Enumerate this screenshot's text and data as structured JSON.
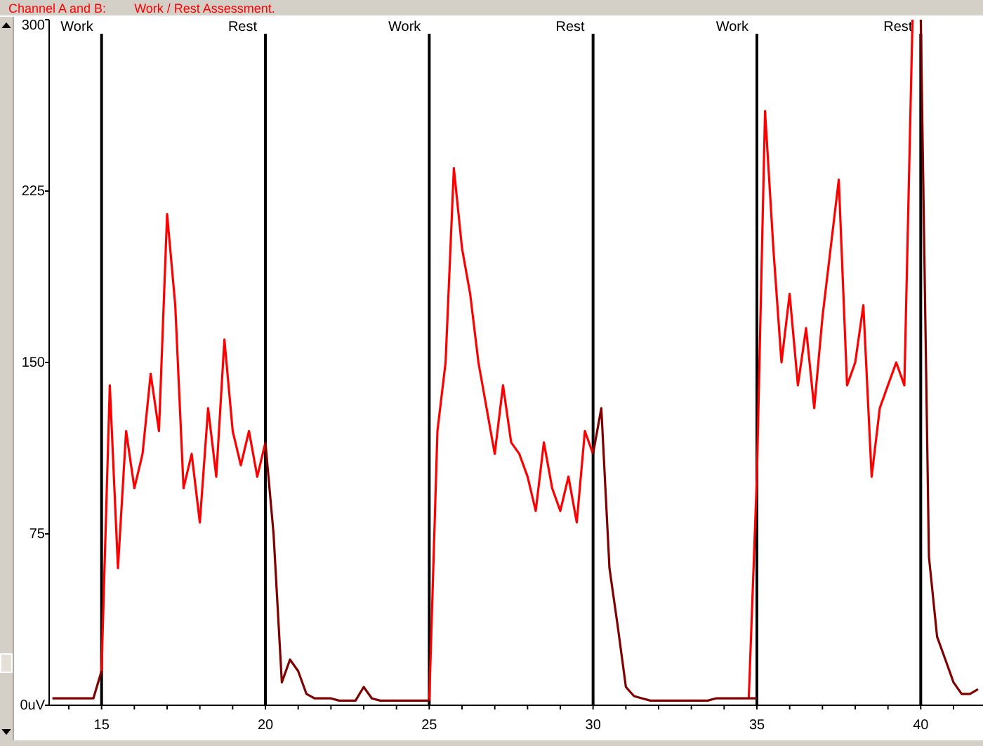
{
  "header": {
    "channel": "Channel A and B:",
    "title": "Work / Rest Assessment."
  },
  "chart": {
    "chart_data": {
      "type": "line",
      "x": [
        13.5,
        13.75,
        14,
        14.25,
        14.5,
        14.75,
        15,
        15.25,
        15.5,
        15.75,
        16,
        16.25,
        16.5,
        16.75,
        17,
        17.25,
        17.5,
        17.75,
        18,
        18.25,
        18.5,
        18.75,
        19,
        19.25,
        19.5,
        19.75,
        20,
        20.25,
        20.5,
        20.75,
        21,
        21.25,
        21.5,
        21.75,
        22,
        22.25,
        22.5,
        22.75,
        23,
        23.25,
        23.5,
        23.75,
        24,
        24.25,
        24.5,
        24.75,
        25,
        25.25,
        25.5,
        25.75,
        26,
        26.25,
        26.5,
        26.75,
        27,
        27.25,
        27.5,
        27.75,
        28,
        28.25,
        28.5,
        28.75,
        29,
        29.25,
        29.5,
        29.75,
        30,
        30.25,
        30.5,
        30.75,
        31,
        31.25,
        31.5,
        31.75,
        32,
        32.25,
        32.5,
        32.75,
        33,
        33.25,
        33.5,
        33.75,
        34,
        34.25,
        34.5,
        34.75,
        35,
        35.25,
        35.5,
        35.75,
        36,
        36.25,
        36.5,
        36.75,
        37,
        37.25,
        37.5,
        37.75,
        38,
        38.25,
        38.5,
        38.75,
        39,
        39.25,
        39.5,
        39.75,
        40,
        40.25,
        40.5,
        40.75,
        41,
        41.25,
        41.5,
        41.75
      ],
      "series": [
        {
          "color": "#ff0000",
          "values": [
            null,
            null,
            null,
            null,
            null,
            null,
            15,
            140,
            60,
            120,
            95,
            110,
            145,
            120,
            215,
            175,
            95,
            110,
            80,
            130,
            100,
            160,
            120,
            105,
            120,
            100,
            115,
            null,
            null,
            null,
            null,
            null,
            null,
            null,
            null,
            null,
            null,
            null,
            null,
            null,
            null,
            null,
            null,
            null,
            null,
            null,
            2,
            120,
            150,
            235,
            200,
            180,
            150,
            130,
            110,
            140,
            115,
            110,
            100,
            85,
            115,
            95,
            85,
            100,
            80,
            120,
            110,
            null,
            null,
            null,
            null,
            null,
            null,
            null,
            null,
            null,
            null,
            null,
            null,
            null,
            null,
            null,
            null,
            null,
            null,
            3,
            100,
            260,
            200,
            150,
            180,
            140,
            165,
            130,
            170,
            200,
            230,
            140,
            150,
            175,
            100,
            130,
            140,
            150,
            140,
            300,
            null,
            null,
            null,
            null,
            null,
            null,
            null,
            null
          ]
        },
        {
          "color": "#800000",
          "values": [
            3,
            3,
            3,
            3,
            3,
            3,
            15,
            null,
            null,
            null,
            null,
            null,
            null,
            null,
            null,
            null,
            null,
            null,
            null,
            null,
            null,
            null,
            null,
            null,
            null,
            null,
            115,
            75,
            10,
            20,
            15,
            5,
            3,
            3,
            3,
            2,
            2,
            2,
            8,
            3,
            2,
            2,
            2,
            2,
            2,
            2,
            2,
            null,
            null,
            null,
            null,
            null,
            null,
            null,
            null,
            null,
            null,
            null,
            null,
            null,
            null,
            null,
            null,
            null,
            null,
            null,
            110,
            130,
            60,
            35,
            8,
            4,
            3,
            2,
            2,
            2,
            2,
            2,
            2,
            2,
            2,
            3,
            3,
            3,
            3,
            3,
            3,
            null,
            null,
            null,
            null,
            null,
            null,
            null,
            null,
            null,
            null,
            null,
            null,
            null,
            null,
            null,
            null,
            null,
            null,
            null,
            300,
            65,
            30,
            20,
            10,
            5,
            5,
            7
          ]
        }
      ],
      "xlim": [
        13.4,
        41.9
      ],
      "ylim": [
        0,
        300
      ],
      "xticks": [
        15,
        20,
        25,
        30,
        35,
        40
      ],
      "yticks": [
        {
          "value": 0,
          "label": "0uV"
        },
        75,
        150,
        225,
        300
      ],
      "grid": true,
      "annotations": [
        "Work",
        "Rest",
        "Work",
        "Rest",
        "Work",
        "Rest"
      ]
    }
  }
}
